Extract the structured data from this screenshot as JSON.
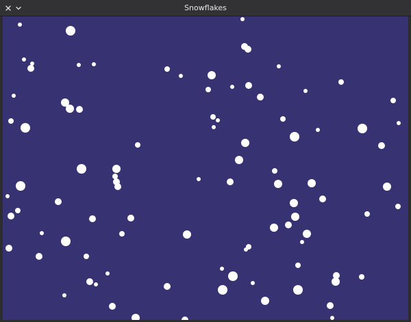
{
  "window": {
    "title": "Snowflakes",
    "close_icon": "close-icon",
    "menu_icon": "chevron-down-icon"
  },
  "colors": {
    "sky": "#373272",
    "flake": "#ffffff",
    "titlebar": "#323234",
    "title_text": "#e8e8e8"
  }
}
